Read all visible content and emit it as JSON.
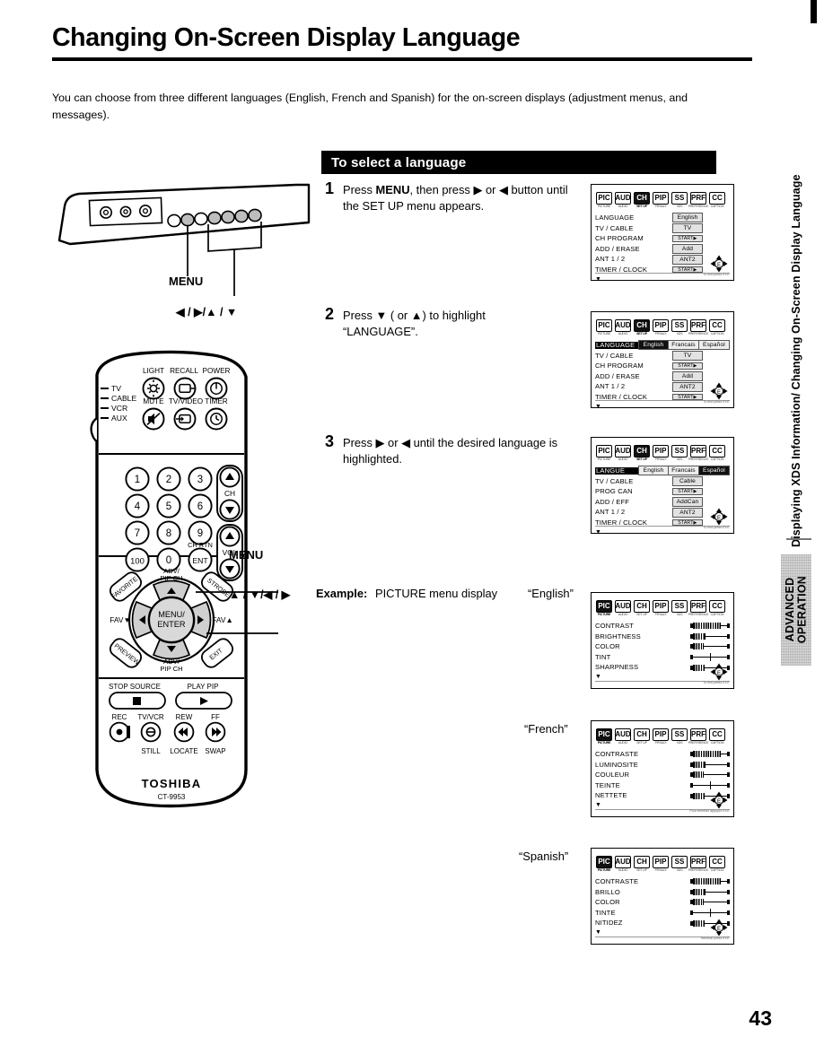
{
  "page": {
    "title": "Changing On-Screen Display Language",
    "intro": "You can choose from three different languages (English, French and Spanish) for the on-screen displays (adjustment menus, and messages).",
    "number": "43",
    "running_head": "Displaying XDS Information/ Changing On-Screen Display Language",
    "section_tab": "ADVANCED\nOPERATION"
  },
  "banner": {
    "label": "To select a language"
  },
  "steps": [
    {
      "num": "1",
      "text_before": "Press ",
      "bold": "MENU",
      "text_after": ", then press ▶ or ◀ button until the SET UP menu appears."
    },
    {
      "num": "2",
      "text_before": "Press ▼ ( or ▲) to highlight",
      "bold": "",
      "text_after": "“LANGUAGE”."
    },
    {
      "num": "3",
      "text_before": "Press ▶ or ◀ until the desired language is highlighted.",
      "bold": "",
      "text_after": ""
    }
  ],
  "osd_iconbar": [
    {
      "glyph": "PIC",
      "cap": "PICTURE"
    },
    {
      "glyph": "AUD",
      "cap": "AUDIO"
    },
    {
      "glyph": "CH",
      "cap": "SET UP"
    },
    {
      "glyph": "PIP",
      "cap": "PIP/AUX"
    },
    {
      "glyph": "SS",
      "cap": "XDS"
    },
    {
      "glyph": "PRF",
      "cap": "PREFERENCE"
    },
    {
      "glyph": "CC",
      "cap": "CAPTION"
    }
  ],
  "osd_screens": {
    "step1": {
      "selected_icon": 2,
      "rows": [
        {
          "label": "LANGUAGE",
          "value": "English"
        },
        {
          "label": "TV / CABLE",
          "value": "TV"
        },
        {
          "label": "CH  PROGRAM",
          "value": "START▶"
        },
        {
          "label": "ADD / ERASE",
          "value": "Add"
        },
        {
          "label": "ANT 1 / 2",
          "value": "ANT2"
        },
        {
          "label": "TIMER / CLOCK",
          "value": "START▶"
        }
      ],
      "footer": "To end press EXIT"
    },
    "step2": {
      "selected_icon": 2,
      "highlight_row": 0,
      "options": [
        "English",
        "Francais",
        "Español"
      ],
      "option_selected": 0,
      "rows": [
        {
          "label": "LANGUAGE",
          "value": "English"
        },
        {
          "label": "TV / CABLE",
          "value": "TV"
        },
        {
          "label": "CH  PROGRAM",
          "value": "START▶"
        },
        {
          "label": "ADD / ERASE",
          "value": "Add"
        },
        {
          "label": "ANT 1 / 2",
          "value": "ANT2"
        },
        {
          "label": "TIMER / CLOCK",
          "value": "START▶"
        }
      ],
      "footer": "To end press EXIT"
    },
    "step3": {
      "selected_icon": 2,
      "highlight_row": 0,
      "options": [
        "English",
        "Francais",
        "Español"
      ],
      "option_selected": 2,
      "rows": [
        {
          "label": "LANGUE",
          "value": "English"
        },
        {
          "label": "TV / CABLE",
          "value": "Cable"
        },
        {
          "label": "PROG  CAN",
          "value": "START▶"
        },
        {
          "label": "ADD / EFF",
          "value": "AddCan"
        },
        {
          "label": "ANT 1 / 2",
          "value": "ANT2"
        },
        {
          "label": "TIMER / CLOCK",
          "value": "START▶"
        }
      ],
      "footer": "To end press EXIT"
    }
  },
  "example": {
    "label": "Example:",
    "description": "PICTURE menu display",
    "captions": {
      "english": "“English”",
      "french": "“French”",
      "spanish": "“Spanish”"
    },
    "picture_menus": {
      "english": {
        "selected_icon": 0,
        "footer": "To end press EXIT",
        "rows": [
          {
            "label": "CONTRAST",
            "pos": 78,
            "style": "bar"
          },
          {
            "label": "BRIGHTNESS",
            "pos": 34,
            "style": "bar"
          },
          {
            "label": "COLOR",
            "pos": 30,
            "style": "bar"
          },
          {
            "label": "TINT",
            "pos": 50,
            "style": "tick"
          },
          {
            "label": "SHARPNESS",
            "pos": 32,
            "style": "bar"
          }
        ]
      },
      "french": {
        "selected_icon": 0,
        "footer": "Pour terminer appuyer EXIT",
        "rows": [
          {
            "label": "CONTRASTE",
            "pos": 78,
            "style": "bar"
          },
          {
            "label": "LUMINOSITE",
            "pos": 34,
            "style": "bar"
          },
          {
            "label": "COULEUR",
            "pos": 30,
            "style": "bar"
          },
          {
            "label": "TEINTE",
            "pos": 50,
            "style": "tick"
          },
          {
            "label": "NETTETE",
            "pos": 32,
            "style": "bar"
          }
        ]
      },
      "spanish": {
        "selected_icon": 0,
        "footer": "Terminar press EXIT",
        "rows": [
          {
            "label": "CONTRASTE",
            "pos": 78,
            "style": "bar"
          },
          {
            "label": "BRILLO",
            "pos": 34,
            "style": "bar"
          },
          {
            "label": "COLOR",
            "pos": 30,
            "style": "bar"
          },
          {
            "label": "TINTE",
            "pos": 50,
            "style": "tick"
          },
          {
            "label": "NITIDEZ",
            "pos": 32,
            "style": "bar"
          }
        ]
      }
    }
  },
  "tv_panel": {
    "menu_label": "MENU",
    "arrows_label": "◀ / ▶/▲ / ▼"
  },
  "remote": {
    "brand": "TOSHIBA",
    "model": "CT-9953",
    "menu_label": "MENU",
    "arrows_label": "▲ / ▼/◀ / ▶",
    "mode_switch": [
      "TV",
      "CABLE",
      "VCR",
      "AUX"
    ],
    "top_buttons": [
      "LIGHT",
      "RECALL",
      "POWER",
      "MUTE",
      "TV/VIDEO",
      "TIMER"
    ],
    "keypad": [
      "1",
      "2",
      "3",
      "4",
      "5",
      "6",
      "7",
      "8",
      "9",
      "100",
      "0",
      "ENT"
    ],
    "keypad_sub": "CH RTN",
    "ch_label": "CH",
    "vol_label": "VOL",
    "cluster": {
      "top": "ADV/\nPIP CH",
      "bottom": "ADV/\nPIP CH",
      "left": "FAV▼",
      "right": "FAV▲",
      "center": "MENU/\nENTER",
      "corner_tl": "FAVORITE",
      "corner_tr": "STROBE",
      "corner_bl": "PREVIEW",
      "corner_br": "EXIT"
    },
    "transport_top": [
      "STOP SOURCE",
      "PLAY PIP"
    ],
    "transport_labels_above": [
      "REC",
      "TV/VCR",
      "REW",
      "FF"
    ],
    "transport_labels_below": [
      "STILL",
      "LOCATE",
      "SWAP"
    ]
  }
}
